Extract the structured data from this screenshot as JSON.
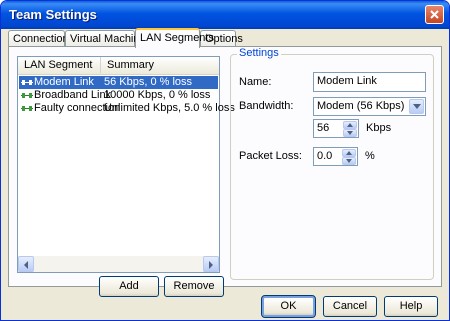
{
  "window": {
    "title": "Team Settings"
  },
  "tabs": [
    {
      "label": "Connections"
    },
    {
      "label": "Virtual Machines"
    },
    {
      "label": "LAN Segments",
      "active": true
    },
    {
      "label": "Options"
    }
  ],
  "segments_list": {
    "columns": [
      "LAN Segment",
      "Summary"
    ],
    "rows": [
      {
        "name": "Modem Link",
        "summary": "56 Kbps, 0 % loss",
        "selected": true
      },
      {
        "name": "Broadband Link",
        "summary": "10000 Kbps, 0 % loss",
        "selected": false
      },
      {
        "name": "Faulty connection",
        "summary": "Unlimited Kbps, 5.0 % loss",
        "selected": false
      }
    ]
  },
  "list_buttons": {
    "add": "Add",
    "remove": "Remove"
  },
  "settings": {
    "group_label": "Settings",
    "name_label": "Name:",
    "name_value": "Modem Link",
    "bandwidth_label": "Bandwidth:",
    "bandwidth_selected": "Modem (56 Kbps)",
    "bandwidth_value": "56",
    "bandwidth_unit": "Kbps",
    "packet_loss_label": "Packet Loss:",
    "packet_loss_value": "0.0",
    "packet_loss_unit": "%"
  },
  "dialog_buttons": {
    "ok": "OK",
    "cancel": "Cancel",
    "help": "Help"
  },
  "colors": {
    "titlebar": "#0054e3",
    "selection": "#316ac5",
    "group_label": "#0046d5",
    "dialog_bg": "#ece9d8"
  }
}
